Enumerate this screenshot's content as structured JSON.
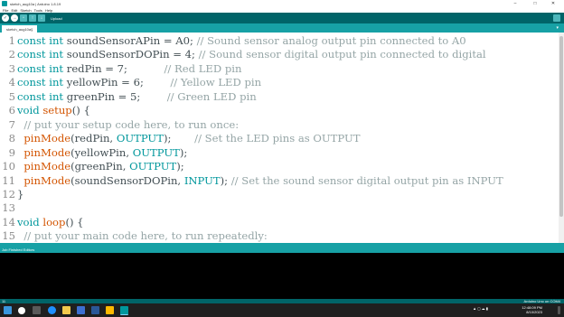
{
  "window": {
    "title": "sketch_aug10a | Arduino 1.8.19",
    "minimize": "–",
    "maximize": "□",
    "close": "✕"
  },
  "menu": [
    "File",
    "Edit",
    "Sketch",
    "Tools",
    "Help"
  ],
  "toolbar": {
    "verify": "✓",
    "upload": "→",
    "new": "▫",
    "open": "↑",
    "save": "↓",
    "label": "Upload"
  },
  "tab": {
    "name": "sketch_aug10a§",
    "menu": "▾"
  },
  "code": [
    {
      "num": "1",
      "tokens": [
        [
          "kw",
          "const"
        ],
        [
          "tx",
          " "
        ],
        [
          "kw",
          "int"
        ],
        [
          "tx",
          " soundSensorAPin = A0; "
        ],
        [
          "cm",
          "// Sound sensor analog output pin connected to A0"
        ]
      ]
    },
    {
      "num": "2",
      "tokens": [
        [
          "kw",
          "const"
        ],
        [
          "tx",
          " "
        ],
        [
          "kw",
          "int"
        ],
        [
          "tx",
          " soundSensorDOPin = 4; "
        ],
        [
          "cm",
          "// Sound sensor digital output pin connected to digital"
        ]
      ]
    },
    {
      "num": "3",
      "tokens": [
        [
          "kw",
          "const"
        ],
        [
          "tx",
          " "
        ],
        [
          "kw",
          "int"
        ],
        [
          "tx",
          " redPin = 7;           "
        ],
        [
          "cm",
          "// Red LED pin"
        ]
      ]
    },
    {
      "num": "4",
      "tokens": [
        [
          "kw",
          "const"
        ],
        [
          "tx",
          " "
        ],
        [
          "kw",
          "int"
        ],
        [
          "tx",
          " yellowPin = 6;        "
        ],
        [
          "cm",
          "// Yellow LED pin"
        ]
      ]
    },
    {
      "num": "5",
      "tokens": [
        [
          "kw",
          "const"
        ],
        [
          "tx",
          " "
        ],
        [
          "kw",
          "int"
        ],
        [
          "tx",
          " greenPin = 5;        "
        ],
        [
          "cm",
          "// Green LED pin"
        ]
      ]
    },
    {
      "num": "6",
      "tokens": [
        [
          "kw",
          "void"
        ],
        [
          "tx",
          " "
        ],
        [
          "fn",
          "setup"
        ],
        [
          "tx",
          "() {"
        ]
      ]
    },
    {
      "num": "7",
      "tokens": [
        [
          "tx",
          "  "
        ],
        [
          "cm",
          "// put your setup code here, to run once:"
        ]
      ]
    },
    {
      "num": "8",
      "tokens": [
        [
          "tx",
          "  "
        ],
        [
          "fn",
          "pinMode"
        ],
        [
          "tx",
          "(redPin, "
        ],
        [
          "cn",
          "OUTPUT"
        ],
        [
          "tx",
          ");       "
        ],
        [
          "cm",
          "// Set the LED pins as OUTPUT"
        ]
      ]
    },
    {
      "num": "9",
      "tokens": [
        [
          "tx",
          "  "
        ],
        [
          "fn",
          "pinMode"
        ],
        [
          "tx",
          "(yellowPin, "
        ],
        [
          "cn",
          "OUTPUT"
        ],
        [
          "tx",
          ");"
        ]
      ]
    },
    {
      "num": "10",
      "tokens": [
        [
          "tx",
          "  "
        ],
        [
          "fn",
          "pinMode"
        ],
        [
          "tx",
          "(greenPin, "
        ],
        [
          "cn",
          "OUTPUT"
        ],
        [
          "tx",
          ");"
        ]
      ]
    },
    {
      "num": "11",
      "tokens": [
        [
          "tx",
          "  "
        ],
        [
          "fn",
          "pinMode"
        ],
        [
          "tx",
          "(soundSensorDOPin, "
        ],
        [
          "cn",
          "INPUT"
        ],
        [
          "tx",
          "); "
        ],
        [
          "cm",
          "// Set the sound sensor digital output pin as INPUT"
        ]
      ]
    },
    {
      "num": "12",
      "tokens": [
        [
          "tx",
          "}"
        ]
      ]
    },
    {
      "num": "13",
      "tokens": []
    },
    {
      "num": "14",
      "tokens": [
        [
          "kw",
          "void"
        ],
        [
          "tx",
          " "
        ],
        [
          "fn",
          "loop"
        ],
        [
          "tx",
          "() {"
        ]
      ]
    },
    {
      "num": "15",
      "tokens": [
        [
          "tx",
          "  "
        ],
        [
          "cm",
          "// put your main code here, to run repeatedly:"
        ]
      ]
    }
  ],
  "status": {
    "message": "Job Finished Editors",
    "line_count": "11",
    "board": "Arduino Uno on COM4"
  },
  "taskbar": {
    "time": "12:48:09 PM",
    "date": "8/10/2023"
  },
  "colors": {
    "keyword": "#00979c",
    "function": "#d35400",
    "comment": "#95a5a6",
    "toolbar": "#006468",
    "accent": "#17a1a5"
  }
}
